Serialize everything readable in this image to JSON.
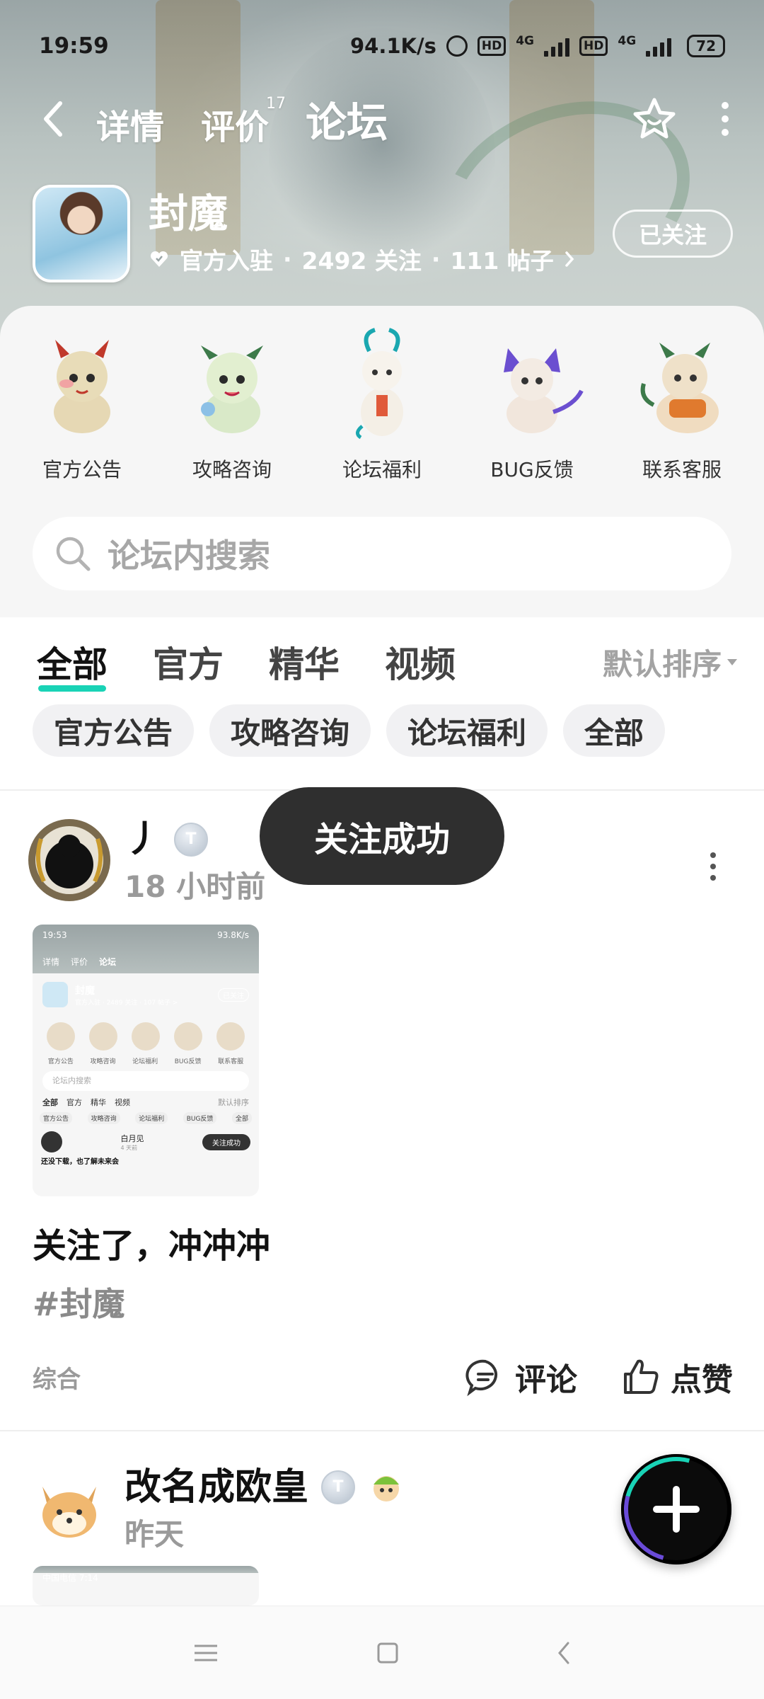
{
  "status_bar": {
    "time": "19:59",
    "speed": "94.1K/s",
    "hd1": "HD",
    "net1": "4G",
    "hd2": "HD",
    "net2": "4G",
    "battery": "72"
  },
  "nav": {
    "tabs": [
      {
        "label": "详情"
      },
      {
        "label": "评价",
        "badge": "17"
      },
      {
        "label": "论坛"
      }
    ],
    "active_tab": "论坛",
    "accent_color": "#19d3b6"
  },
  "game": {
    "name": "封魔",
    "official": "官方入驻",
    "followers": "2492 关注",
    "posts": "111 帖子",
    "follow_button": "已关注"
  },
  "categories": [
    {
      "label": "官方公告",
      "icon": "dragon-mascot-red-icon"
    },
    {
      "label": "攻略咨询",
      "icon": "dragon-mascot-green-icon"
    },
    {
      "label": "论坛福利",
      "icon": "dragon-mascot-white-icon"
    },
    {
      "label": "BUG反馈",
      "icon": "dragon-mascot-purple-icon"
    },
    {
      "label": "联系客服",
      "icon": "dragon-mascot-orange-icon"
    }
  ],
  "search": {
    "placeholder": "论坛内搜索"
  },
  "feed": {
    "tabs": [
      "全部",
      "官方",
      "精华",
      "视频"
    ],
    "active_tab": "全部",
    "sort": "默认排序",
    "chips": [
      "官方公告",
      "攻略咨询",
      "论坛福利",
      "全部"
    ]
  },
  "posts": [
    {
      "user": "丿",
      "time": "18 小时前",
      "title": "关注了，冲冲冲",
      "tag": "#封魔",
      "category": "综合",
      "comment": "评论",
      "like": "点赞"
    },
    {
      "user": "改名成欧皇",
      "time": "昨天"
    }
  ],
  "thumb": {
    "time": "19:53",
    "speed": "93.8K/s",
    "tab_detail": "详情",
    "tab_review": "评价",
    "tab_forum": "论坛",
    "game_name": "封魔",
    "game_sub": "官方入驻 · 2489 关注 · 107 帖子 >",
    "follow": "已关注",
    "cats": [
      "官方公告",
      "攻略咨询",
      "论坛福利",
      "BUG反馈",
      "联系客服"
    ],
    "search": "论坛内搜索",
    "tabs": [
      "全部",
      "官方",
      "精华",
      "视频"
    ],
    "sort": "默认排序",
    "chips": [
      "官方公告",
      "攻略咨询",
      "论坛福利",
      "BUG反馈",
      "全部"
    ],
    "user": "白月见",
    "user_time": "4 天前",
    "toast": "关注成功",
    "snippet": "还没下载，也了解未来会"
  },
  "thumb2": {
    "carrier_time": "中国电信 7:14"
  },
  "toast": "关注成功"
}
